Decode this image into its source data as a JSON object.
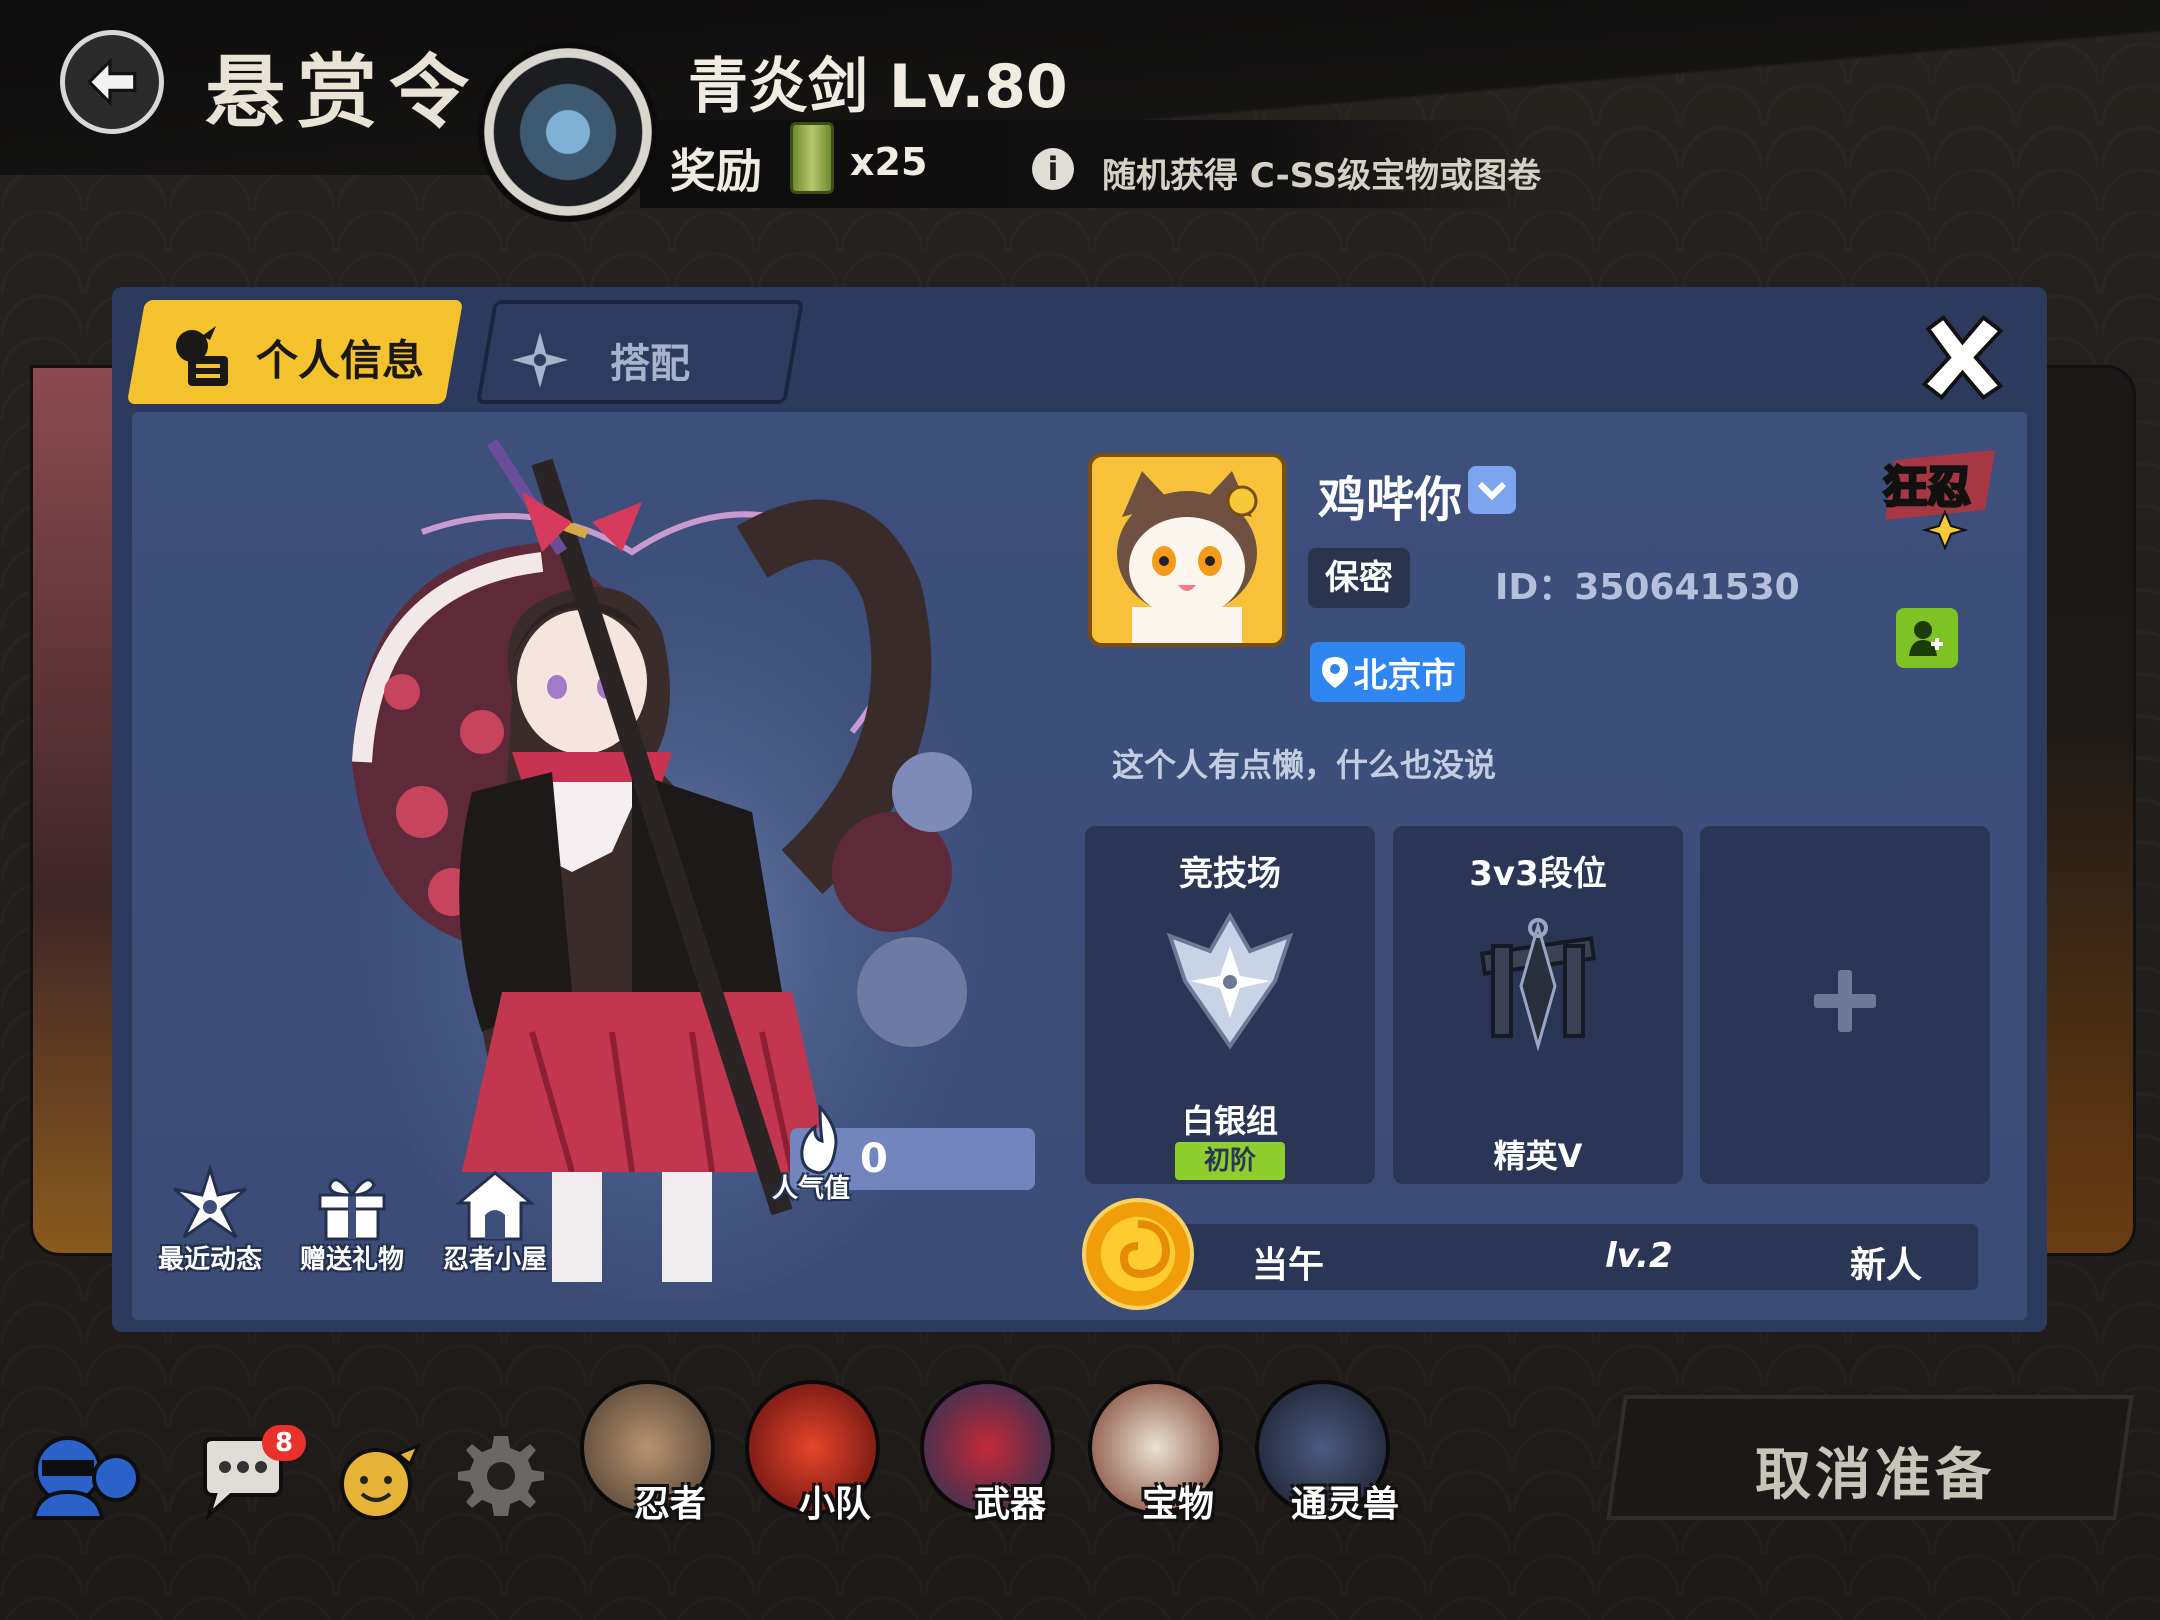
{
  "header": {
    "title": "悬赏令",
    "quest_name": "青炎剑 Lv.80",
    "reward_label": "奖励",
    "reward_count": "x25",
    "reward_desc": "随机获得 C-SS级宝物或图卷"
  },
  "tabs": [
    {
      "label": "个人信息",
      "active": true
    },
    {
      "label": "搭配",
      "active": false
    }
  ],
  "profile": {
    "username": "鸡哔你",
    "gender": "保密",
    "id_text": "ID：350641530",
    "location": "北京市",
    "bio": "这个人有点懒，什么也没说",
    "rank_logo_text": "狂忍"
  },
  "popularity": {
    "label": "人气值",
    "value": "0"
  },
  "actions": [
    {
      "label": "最近动态",
      "icon": "shuriken-icon"
    },
    {
      "label": "赠送礼物",
      "icon": "gift-icon"
    },
    {
      "label": "忍者小屋",
      "icon": "house-icon"
    }
  ],
  "cards": [
    {
      "title": "竞技场",
      "sub": "白银组",
      "tier": "初阶",
      "icon": "silver-shuriken-icon"
    },
    {
      "title": "3v3段位",
      "sub": "精英V",
      "icon": "kunai-emblem-icon"
    },
    {
      "title": "",
      "sub": "",
      "icon": "plus-icon"
    }
  ],
  "guild": {
    "name": "当午",
    "level": "lv.2",
    "role": "新人"
  },
  "bottom": {
    "chat_badge": "8",
    "nav": [
      {
        "label": "忍者",
        "color": "#6b5a4f"
      },
      {
        "label": "小队",
        "color": "#8a1d1d"
      },
      {
        "label": "武器",
        "color": "#2a3f5c"
      },
      {
        "label": "宝物",
        "color": "#7a3a2a"
      },
      {
        "label": "通灵兽",
        "color": "#2b2e44"
      }
    ],
    "cancel_label": "取消准备"
  },
  "colors": {
    "panel": "#2c3a5e",
    "active_tab": "#f3c22c",
    "location": "#2f86f0",
    "tier_badge": "#8ecf2e",
    "add_friend": "#7ec224"
  }
}
